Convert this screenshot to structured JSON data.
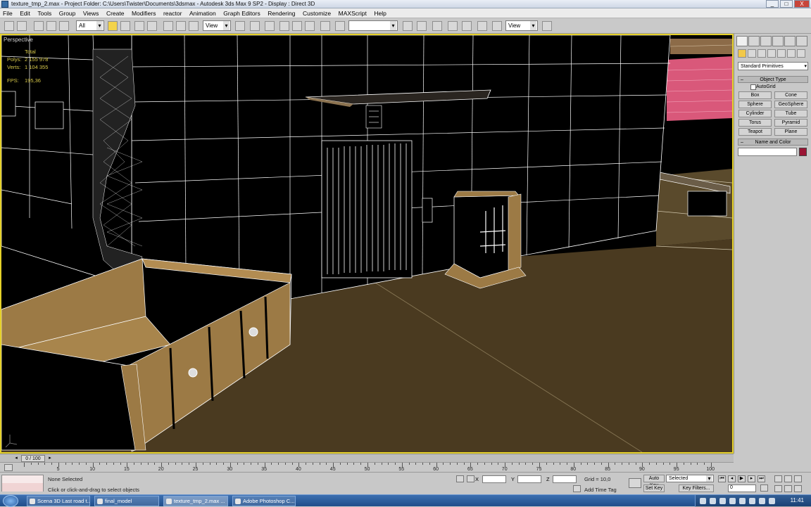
{
  "window": {
    "title": "texture_tmp_2.max   - Project Folder: C:\\Users\\Twister\\Documents\\3dsmax   - Autodesk 3ds Max 9 SP2   - Display : Direct 3D",
    "buttons": [
      "_",
      "□",
      "X"
    ]
  },
  "menu": [
    "File",
    "Edit",
    "Tools",
    "Group",
    "Views",
    "Create",
    "Modifiers",
    "reactor",
    "Animation",
    "Graph Editors",
    "Rendering",
    "Customize",
    "MAXScript",
    "Help"
  ],
  "toolbar": {
    "selection_filter": "All",
    "reference_coord": "View",
    "named_selection": "",
    "view_dropdown_2": "View"
  },
  "viewport": {
    "label": "Perspective",
    "stats": {
      "header": "Total",
      "polys_label": "Polys:",
      "polys": "2 155 978",
      "verts_label": "Verts:",
      "verts": "1 104 355",
      "fps_label": "FPS:",
      "fps": "195,36"
    },
    "colors": {
      "border": "#e6d22a",
      "wire": "#ffffff",
      "ground": "#4a3a20",
      "wood": "#9c7a45",
      "brick": "#d9587a"
    }
  },
  "command_panel": {
    "category": "Standard Primitives",
    "object_type": {
      "title": "Object Type",
      "autogrid": "AutoGrid",
      "buttons": [
        "Box",
        "Cone",
        "Sphere",
        "GeoSphere",
        "Cylinder",
        "Tube",
        "Torus",
        "Pyramid",
        "Teapot",
        "Plane"
      ]
    },
    "name_color": {
      "title": "Name and Color",
      "name": "",
      "color": "#9a1434"
    }
  },
  "timeline": {
    "slider": "0 / 100",
    "ticks": [
      "5",
      "10",
      "15",
      "20",
      "25",
      "30",
      "35",
      "40",
      "45",
      "50",
      "55",
      "60",
      "65",
      "70",
      "75",
      "80",
      "85",
      "90",
      "95",
      "100"
    ]
  },
  "status": {
    "selection": "None Selected",
    "prompt": "Click or click-and-drag to select objects",
    "x_label": "X",
    "y_label": "Y",
    "z_label": "Z",
    "grid": "Grid = 10,0",
    "add_time_tag": "Add Time Tag",
    "auto_key": "Auto Key",
    "set_key": "Set Key",
    "key_mode": "Selected",
    "key_filters": "Key Filters...",
    "frame": "0"
  },
  "taskbar": {
    "items": [
      "Scena 3D Last road t...",
      "final_model",
      "texture_tmp_2.max ...",
      "Adobe Photoshop C..."
    ],
    "active_index": 2,
    "clock": "11:41"
  }
}
